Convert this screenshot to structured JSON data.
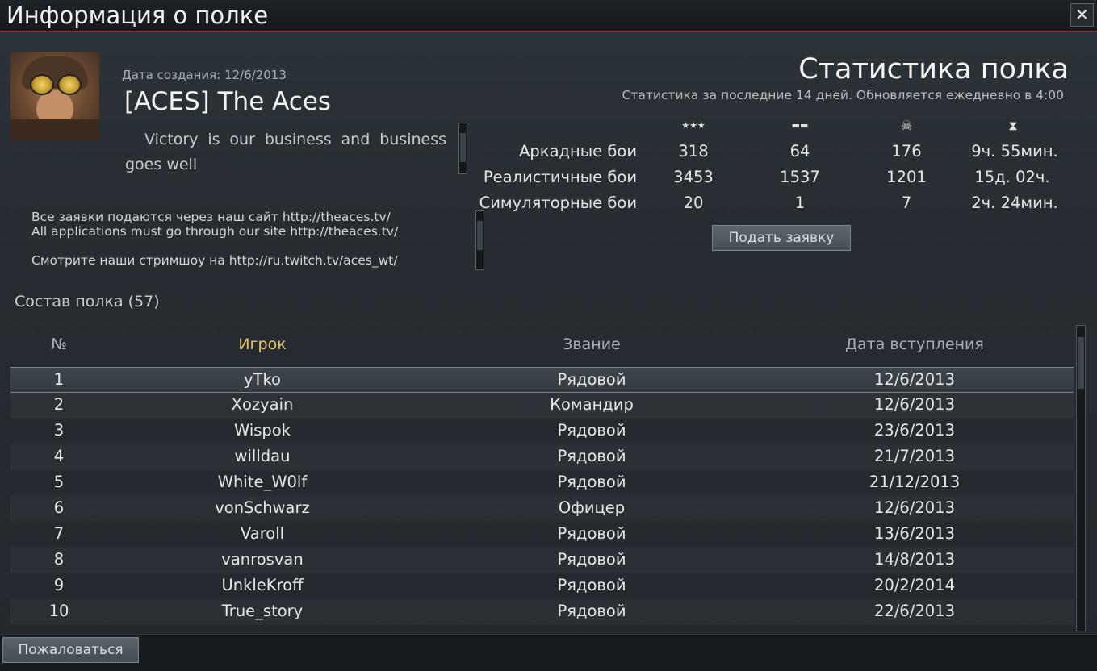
{
  "window": {
    "title": "Информация о полке",
    "close_label": "✕"
  },
  "clan": {
    "created": "Дата создания: 12/6/2013",
    "name": "[ACES] The Aces",
    "motto": "Victory is our business and business goes well",
    "description": [
      "Все заявки подаются через наш сайт http://theaces.tv/",
      "All applications must go through our site http://theaces.tv/",
      "",
      "Смотрите наши стримшоу на http://ru.twitch.tv/aces_wt/"
    ]
  },
  "stats": {
    "title": "Статистика полка",
    "subtitle": "Статистика за последние 14 дней. Обновляется ежедневно в 4:00",
    "columns": [
      {
        "icon": "air-victories-icon",
        "glyph": "★★★"
      },
      {
        "icon": "ground-victories-icon",
        "glyph": "▬▬"
      },
      {
        "icon": "skull-icon",
        "glyph": "☠"
      },
      {
        "icon": "hourglass-icon",
        "glyph": "⧗"
      }
    ],
    "rows": [
      {
        "label": "Аркадные бои",
        "values": [
          "318",
          "64",
          "176",
          "9ч. 55мин."
        ]
      },
      {
        "label": "Реалистичные бои",
        "values": [
          "3453",
          "1537",
          "1201",
          "15д. 02ч."
        ]
      },
      {
        "label": "Симуляторные бои",
        "values": [
          "20",
          "1",
          "7",
          "2ч. 24мин."
        ]
      }
    ],
    "apply_label": "Подать заявку"
  },
  "roster": {
    "title": "Состав полка (57)",
    "headers": {
      "num": "№",
      "player": "Игрок",
      "rank": "Звание",
      "joined": "Дата вступления"
    },
    "rows": [
      {
        "num": "1",
        "player": "yTko",
        "rank": "Рядовой",
        "joined": "12/6/2013"
      },
      {
        "num": "2",
        "player": "Xozyain",
        "rank": "Командир",
        "joined": "12/6/2013"
      },
      {
        "num": "3",
        "player": "Wispok",
        "rank": "Рядовой",
        "joined": "23/6/2013"
      },
      {
        "num": "4",
        "player": "willdau",
        "rank": "Рядовой",
        "joined": "21/7/2013"
      },
      {
        "num": "5",
        "player": "White_W0lf",
        "rank": "Рядовой",
        "joined": "21/12/2013"
      },
      {
        "num": "6",
        "player": "vonSchwarz",
        "rank": "Офицер",
        "joined": "12/6/2013"
      },
      {
        "num": "7",
        "player": "Varoll",
        "rank": "Рядовой",
        "joined": "13/6/2013"
      },
      {
        "num": "8",
        "player": "vanrosvan",
        "rank": "Рядовой",
        "joined": "14/8/2013"
      },
      {
        "num": "9",
        "player": "UnkleKroff",
        "rank": "Рядовой",
        "joined": "20/2/2014"
      },
      {
        "num": "10",
        "player": "True_story",
        "rank": "Рядовой",
        "joined": "22/6/2013"
      }
    ]
  },
  "footer": {
    "report_label": "Пожаловаться"
  }
}
